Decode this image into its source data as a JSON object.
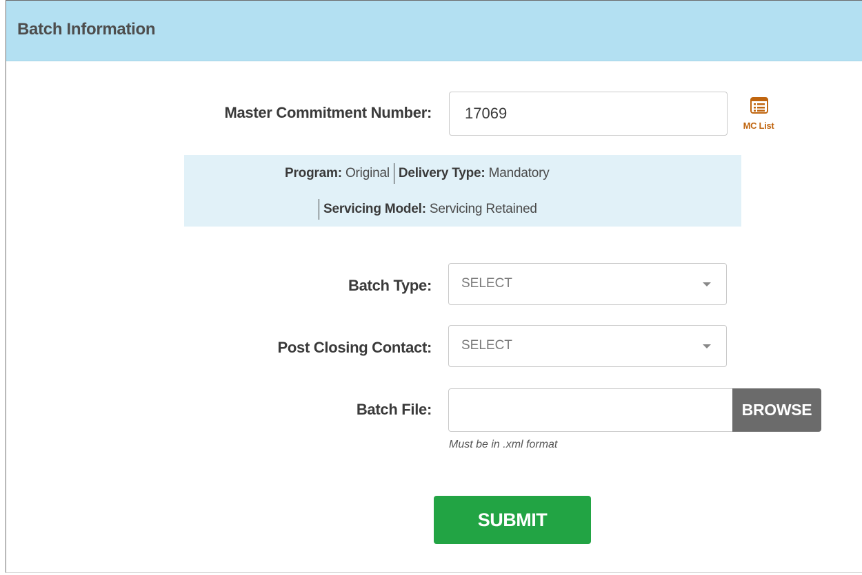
{
  "panel": {
    "title": "Batch Information"
  },
  "master_commitment": {
    "label": "Master Commitment Number:",
    "value": "17069",
    "mc_list_label": "MC List",
    "mc_list_icon": "list-icon"
  },
  "info": {
    "program_label": "Program:",
    "program_value": "Original",
    "delivery_type_label": "Delivery Type:",
    "delivery_type_value": "Mandatory",
    "servicing_model_label": "Servicing Model:",
    "servicing_model_value": "Servicing Retained"
  },
  "batch_type": {
    "label": "Batch Type:",
    "selected": "SELECT"
  },
  "post_closing_contact": {
    "label": "Post Closing Contact:",
    "selected": "SELECT"
  },
  "batch_file": {
    "label": "Batch File:",
    "value": "",
    "browse_label": "BROWSE",
    "hint": "Must be in .xml format"
  },
  "submit": {
    "label": "SUBMIT"
  },
  "colors": {
    "header_bg": "#b3e0f2",
    "info_bg": "#e1f1f8",
    "mc_list_accent": "#c0650f",
    "browse_bg": "#6b6b6b",
    "submit_bg": "#22a444"
  }
}
